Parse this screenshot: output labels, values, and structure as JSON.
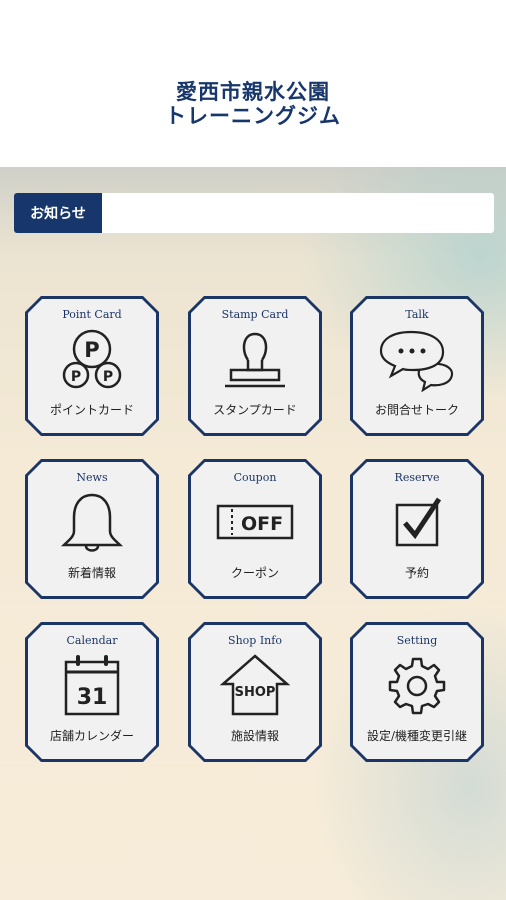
{
  "header": {
    "title_line1": "愛西市親水公園",
    "title_line2": "トレーニングジム"
  },
  "news": {
    "label": "お知らせ",
    "text": ""
  },
  "colors": {
    "brand_navy": "#17366b",
    "tile_background": "#f1f1f1"
  },
  "tiles": [
    {
      "en": "Point Card",
      "jp": "ポイントカード",
      "icon": "point-card-icon"
    },
    {
      "en": "Stamp Card",
      "jp": "スタンプカード",
      "icon": "stamp-icon"
    },
    {
      "en": "Talk",
      "jp": "お問合せトーク",
      "icon": "chat-bubbles-icon"
    },
    {
      "en": "News",
      "jp": "新着情報",
      "icon": "bell-icon"
    },
    {
      "en": "Coupon",
      "jp": "クーポン",
      "icon": "coupon-icon",
      "icon_text": "OFF"
    },
    {
      "en": "Reserve",
      "jp": "予約",
      "icon": "checkbox-icon"
    },
    {
      "en": "Calendar",
      "jp": "店舗カレンダー",
      "icon": "calendar-icon",
      "icon_text": "31"
    },
    {
      "en": "Shop Info",
      "jp": "施設情報",
      "icon": "shop-icon",
      "icon_text": "SHOP"
    },
    {
      "en": "Setting",
      "jp": "設定/機種変更引継",
      "icon": "gear-icon"
    }
  ]
}
